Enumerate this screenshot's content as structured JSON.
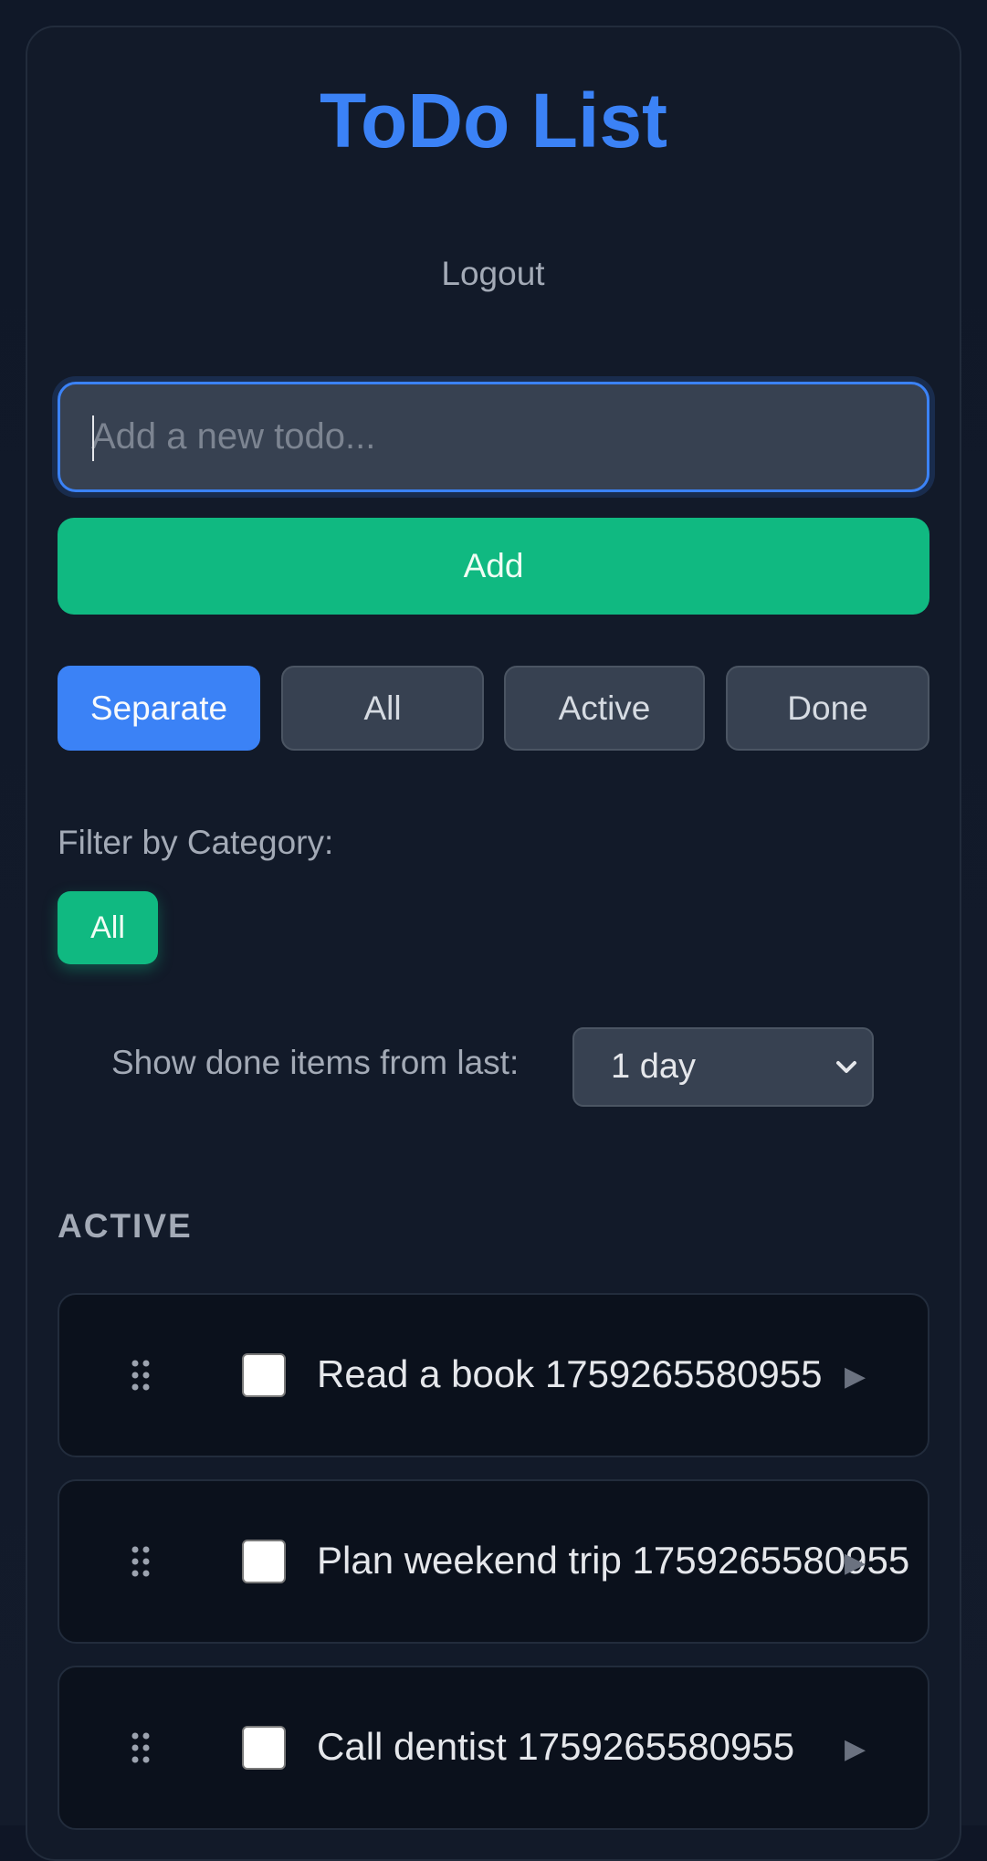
{
  "header": {
    "title": "ToDo List",
    "logout_label": "Logout"
  },
  "composer": {
    "placeholder": "Add a new todo...",
    "value": "",
    "add_label": "Add"
  },
  "view_modes": {
    "selected": "Separate",
    "items": [
      {
        "label": "Separate"
      },
      {
        "label": "All"
      },
      {
        "label": "Active"
      },
      {
        "label": "Done"
      }
    ]
  },
  "category_filter": {
    "label": "Filter by Category:",
    "chips": [
      {
        "label": "All",
        "selected": true
      }
    ]
  },
  "done_window": {
    "label": "Show done items from last:",
    "selected": "1 day"
  },
  "sections": {
    "active": {
      "title": "ACTIVE",
      "items": [
        {
          "text": "Read a book 1759265580955",
          "done": false
        },
        {
          "text": "Plan weekend trip 1759265580955",
          "done": false
        },
        {
          "text": "Call dentist 1759265580955",
          "done": false
        }
      ]
    }
  },
  "icons": {
    "drag": "drag-handle-icon",
    "expand": "triangle-right-icon",
    "select": "chevron-down-icon"
  },
  "colors": {
    "accent_blue": "#3b82f6",
    "accent_green": "#10b981",
    "background": "#121a29",
    "surface": "#374151",
    "item_bg": "#0b111c",
    "muted_text": "#a3aab6"
  }
}
